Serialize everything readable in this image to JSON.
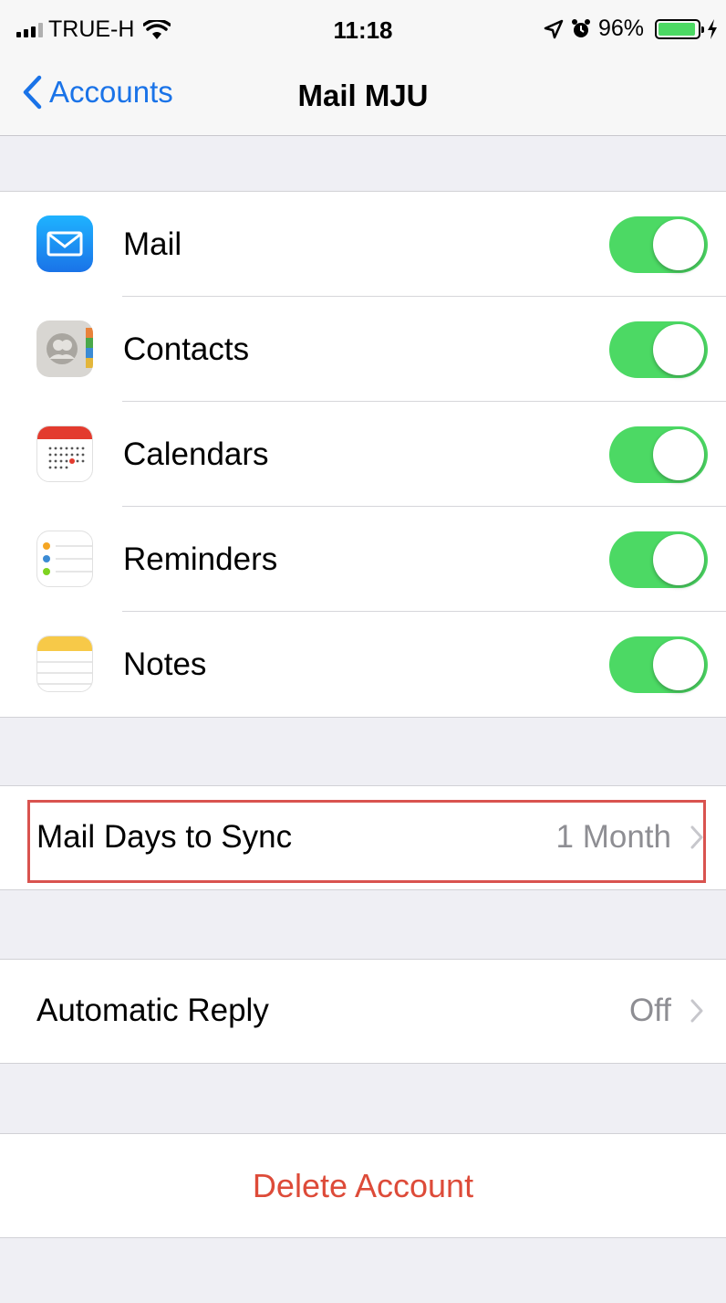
{
  "status_bar": {
    "carrier": "TRUE-H",
    "time": "11:18",
    "battery_percent": "96%",
    "battery_level": 0.96,
    "icons": [
      "signal-icon",
      "wifi-icon",
      "location-icon",
      "alarm-icon",
      "battery-icon",
      "charging-icon"
    ]
  },
  "nav": {
    "back_label": "Accounts",
    "title": "Mail MJU"
  },
  "services": [
    {
      "label": "Mail",
      "icon": "mail-app-icon",
      "enabled": true
    },
    {
      "label": "Contacts",
      "icon": "contacts-app-icon",
      "enabled": true
    },
    {
      "label": "Calendars",
      "icon": "calendar-app-icon",
      "enabled": true
    },
    {
      "label": "Reminders",
      "icon": "reminders-app-icon",
      "enabled": true
    },
    {
      "label": "Notes",
      "icon": "notes-app-icon",
      "enabled": true
    }
  ],
  "sync": {
    "label": "Mail Days to Sync",
    "value": "1 Month"
  },
  "auto_reply": {
    "label": "Automatic Reply",
    "value": "Off"
  },
  "delete": {
    "label": "Delete Account"
  },
  "colors": {
    "accent": "#1a73e8",
    "toggle_on": "#4cd964",
    "destructive": "#dd4b39",
    "highlight_border": "#d9534f"
  }
}
